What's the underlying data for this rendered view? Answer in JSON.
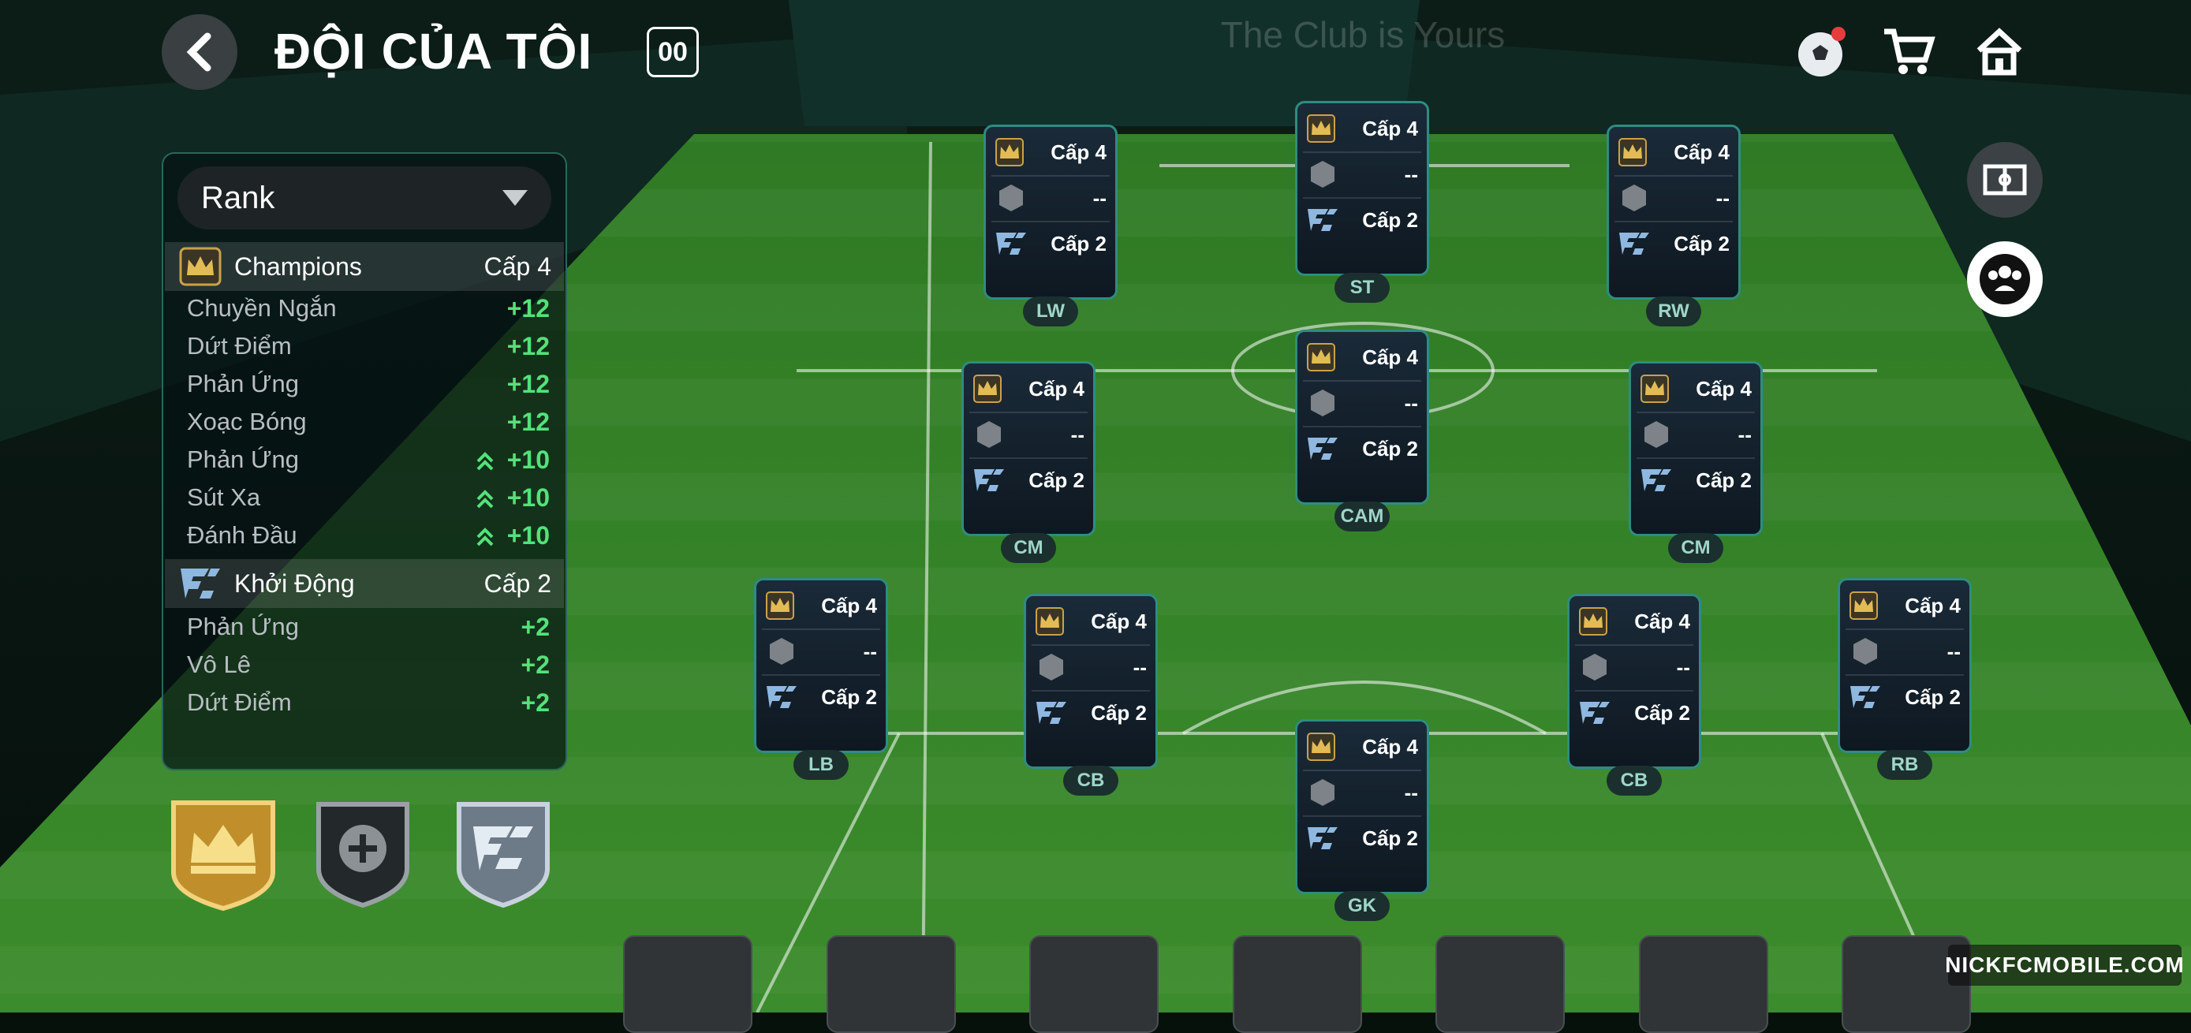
{
  "header": {
    "title": "ĐỘI CỦA TÔI",
    "badge": "00"
  },
  "panel": {
    "dropdown_label": "Rank",
    "groups": [
      {
        "name": "Champions",
        "level": "Cấp 4",
        "stats": [
          {
            "label": "Chuyền Ngắn",
            "value": "+12"
          },
          {
            "label": "Dứt Điểm",
            "value": "+12"
          },
          {
            "label": "Phản Ứng",
            "value": "+12"
          },
          {
            "label": "Xoạc Bóng",
            "value": "+12"
          },
          {
            "label": "Phản Ứng",
            "value": "+10"
          },
          {
            "label": "Sút Xa",
            "value": "+10"
          },
          {
            "label": "Đánh Đầu",
            "value": "+10"
          }
        ]
      },
      {
        "name": "Khởi Động",
        "level": "Cấp 2",
        "stats": [
          {
            "label": "Phản Ứng",
            "value": "+2"
          },
          {
            "label": "Vô Lê",
            "value": "+2"
          },
          {
            "label": "Dứt Điểm",
            "value": "+2"
          }
        ]
      }
    ]
  },
  "cards": [
    {
      "pos": "LW",
      "lvl_top": "Cấp 4",
      "mid": "--",
      "lvl_bot": "Cấp 2"
    },
    {
      "pos": "ST",
      "lvl_top": "Cấp 4",
      "mid": "--",
      "lvl_bot": "Cấp 2"
    },
    {
      "pos": "RW",
      "lvl_top": "Cấp 4",
      "mid": "--",
      "lvl_bot": "Cấp 2"
    },
    {
      "pos": "CM",
      "lvl_top": "Cấp 4",
      "mid": "--",
      "lvl_bot": "Cấp 2"
    },
    {
      "pos": "CAM",
      "lvl_top": "Cấp 4",
      "mid": "--",
      "lvl_bot": "Cấp 2"
    },
    {
      "pos": "CM",
      "lvl_top": "Cấp 4",
      "mid": "--",
      "lvl_bot": "Cấp 2"
    },
    {
      "pos": "LB",
      "lvl_top": "Cấp 4",
      "mid": "--",
      "lvl_bot": "Cấp 2"
    },
    {
      "pos": "CB",
      "lvl_top": "Cấp 4",
      "mid": "--",
      "lvl_bot": "Cấp 2"
    },
    {
      "pos": "GK",
      "lvl_top": "Cấp 4",
      "mid": "--",
      "lvl_bot": "Cấp 2"
    },
    {
      "pos": "CB",
      "lvl_top": "Cấp 4",
      "mid": "--",
      "lvl_bot": "Cấp 2"
    },
    {
      "pos": "RB",
      "lvl_top": "Cấp 4",
      "mid": "--",
      "lvl_bot": "Cấp 2"
    }
  ],
  "background_text": "The Club is Yours",
  "watermark": "NICKFCMOBILE.COM",
  "colors": {
    "accent_green": "#53e27a",
    "card_border": "#2e8c82",
    "pitch": "#3f8a2c"
  },
  "icons": [
    "back-arrow-icon",
    "football-icon",
    "cart-icon",
    "home-icon",
    "pitch-view-icon",
    "team-icon",
    "crown-icon",
    "plus-icon",
    "fc-logo-icon"
  ]
}
